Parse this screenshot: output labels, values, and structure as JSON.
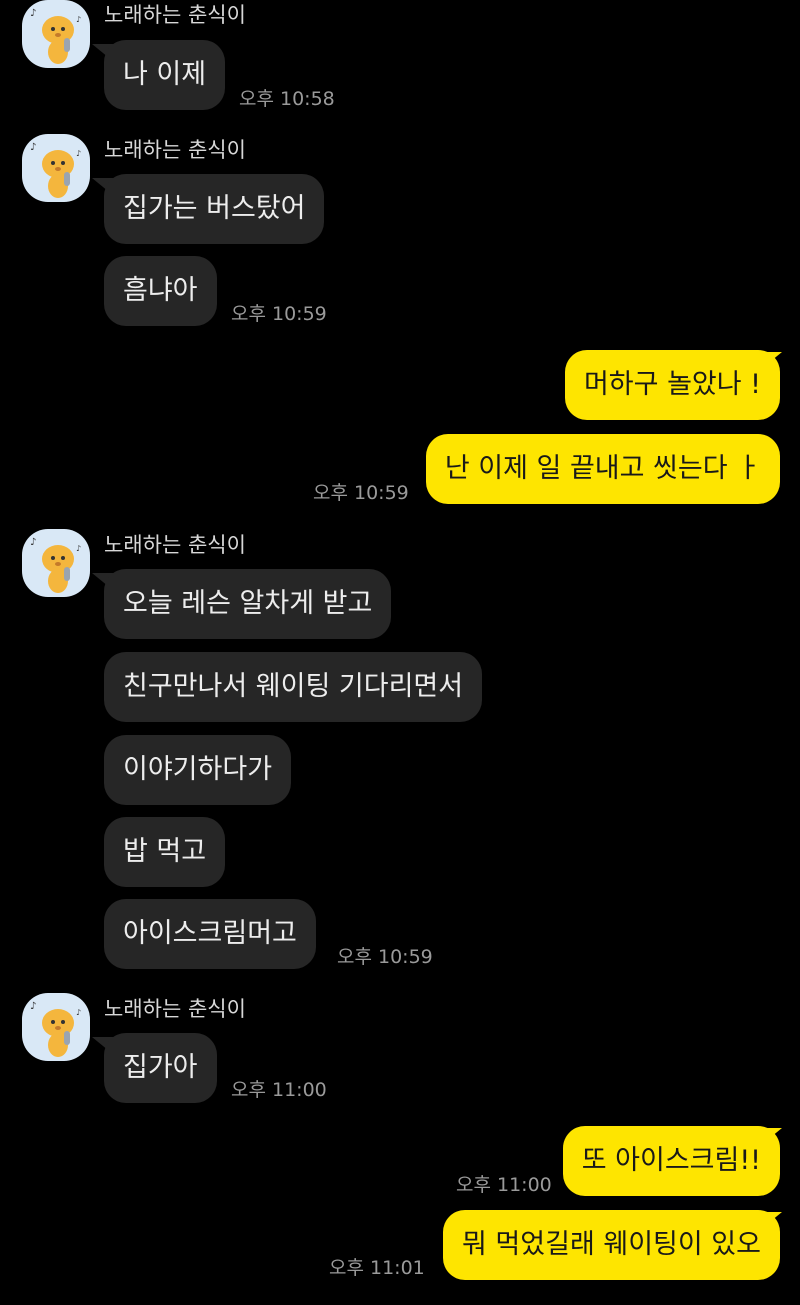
{
  "sender_name": "노래하는 춘식이",
  "groups": [
    {
      "sender": "노래하는 춘식이",
      "messages": [
        "나 이제"
      ],
      "time": "오후 10:58"
    },
    {
      "sender": "노래하는 춘식이",
      "messages": [
        "집가는 버스탔어",
        "흠냐아"
      ],
      "time": "오후 10:59"
    },
    {
      "sender": "me",
      "messages": [
        "머하구 놀았나 !",
        "난 이제 일 끝내고 씻는다 ㅏ"
      ],
      "time": "오후 10:59"
    },
    {
      "sender": "노래하는 춘식이",
      "messages": [
        "오늘 레슨 알차게 받고",
        "친구만나서 웨이팅 기다리면서",
        "이야기하다가",
        "밥 먹고",
        "아이스크림머고"
      ],
      "time": "오후 10:59"
    },
    {
      "sender": "노래하는 춘식이",
      "messages": [
        "집가아"
      ],
      "time": "오후 11:00"
    },
    {
      "sender": "me",
      "messages": [
        "또 아이스크림!!"
      ],
      "time": "오후 11:00"
    },
    {
      "sender": "me",
      "messages": [
        "뭐 먹었길래 웨이팅이 있오"
      ],
      "time": "오후 11:01"
    }
  ],
  "colors": {
    "background": "#000000",
    "incoming_bubble": "#262626",
    "outgoing_bubble": "#fee500",
    "avatar_bg": "#d9e8f6"
  },
  "icons": {
    "avatar": "singing-chunsik-icon"
  }
}
